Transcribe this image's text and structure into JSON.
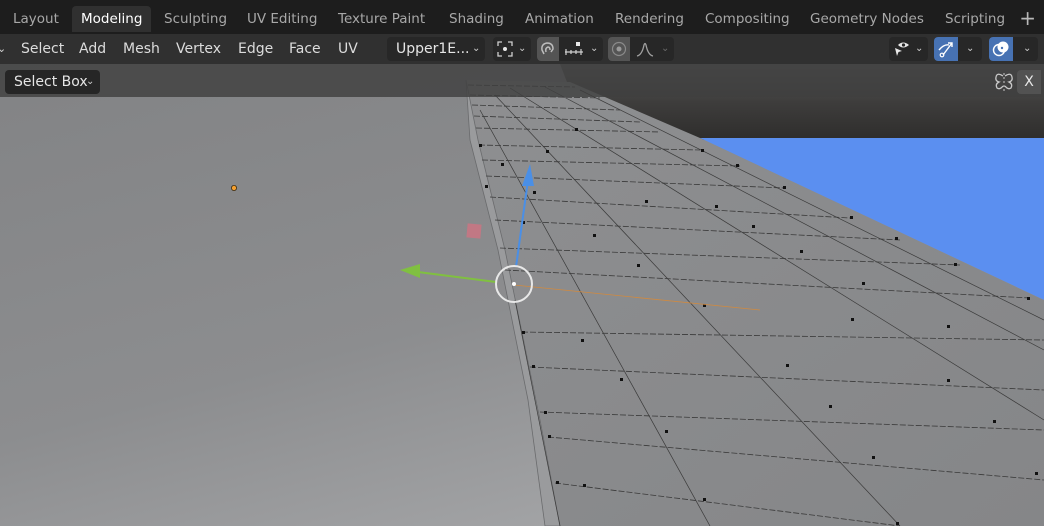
{
  "workspace_tabs": [
    {
      "label": "Layout",
      "active": false
    },
    {
      "label": "Modeling",
      "active": true
    },
    {
      "label": "Sculpting",
      "active": false
    },
    {
      "label": "UV Editing",
      "active": false
    },
    {
      "label": "Texture Paint",
      "active": false
    },
    {
      "label": "Shading",
      "active": false
    },
    {
      "label": "Animation",
      "active": false
    },
    {
      "label": "Rendering",
      "active": false
    },
    {
      "label": "Compositing",
      "active": false
    },
    {
      "label": "Geometry Nodes",
      "active": false
    },
    {
      "label": "Scripting",
      "active": false
    }
  ],
  "add_workspace_icon": "+",
  "header": {
    "menus": [
      "Select",
      "Add",
      "Mesh",
      "Vertex",
      "Edge",
      "Face",
      "UV"
    ],
    "object_dropdown": "Upper1E...",
    "pivot_icon": "pivot-point-icon",
    "snap_icon": "snap-magnet-icon",
    "snap_increment_icon": "snap-increment-icon",
    "proportional_edit_icon": "proportional-edit-icon",
    "falloff_icon": "falloff-curve-icon",
    "visibility_icon": "selectability-visibility-icon",
    "gizmo_icon": "gizmo-icon",
    "overlay_icon": "overlay-icon",
    "accent_color": "#4772b3"
  },
  "tool_settings": {
    "select_mode": "Select Box",
    "mirror_icon": "mirror-butterfly-icon",
    "x_mirror_label": "X"
  },
  "viewport": {
    "mesh_face_color": "#8a8b8d",
    "background_blue": "#5b8ff0",
    "gizmo_x_color": "#e05a6a",
    "gizmo_y_color": "#80c040",
    "gizmo_z_color": "#4a8fe6",
    "origin_dot_color": "#f5a030"
  }
}
